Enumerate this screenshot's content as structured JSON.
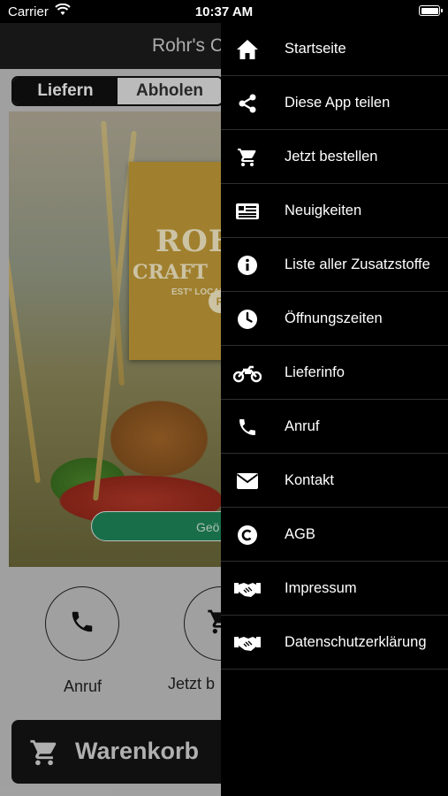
{
  "status_bar": {
    "carrier": "Carrier",
    "time": "10:37 AM"
  },
  "app": {
    "title": "Rohr's Cr",
    "segment": {
      "active": "Liefern",
      "inactive": "Abholen"
    },
    "hero": {
      "logo_line1": "ROH",
      "logo_line2": "CRAFT",
      "logo_line3": "EST° LOCAL",
      "logo_badge": "R",
      "button_label": "Geö"
    },
    "actions": [
      {
        "label": "Anruf",
        "icon": "phone-icon"
      },
      {
        "label": "Jetzt b",
        "icon": "cart-icon"
      }
    ],
    "cart": {
      "label": "Warenkorb",
      "icon": "cart-icon"
    }
  },
  "menu": {
    "items": [
      {
        "label": "Startseite",
        "icon": "home-icon"
      },
      {
        "label": "Diese App teilen",
        "icon": "share-icon"
      },
      {
        "label": "Jetzt bestellen",
        "icon": "cart-icon"
      },
      {
        "label": "Neuigkeiten",
        "icon": "news-icon"
      },
      {
        "label": "Liste aller Zusatzstoffe",
        "icon": "info-icon"
      },
      {
        "label": "Öffnungszeiten",
        "icon": "clock-icon"
      },
      {
        "label": "Lieferinfo",
        "icon": "motorcycle-icon"
      },
      {
        "label": "Anruf",
        "icon": "phone-icon"
      },
      {
        "label": "Kontakt",
        "icon": "envelope-icon"
      },
      {
        "label": "AGB",
        "icon": "copyright-icon"
      },
      {
        "label": "Impressum",
        "icon": "handshake-icon"
      },
      {
        "label": "Datenschutzerklärung",
        "icon": "handshake-icon"
      }
    ]
  }
}
